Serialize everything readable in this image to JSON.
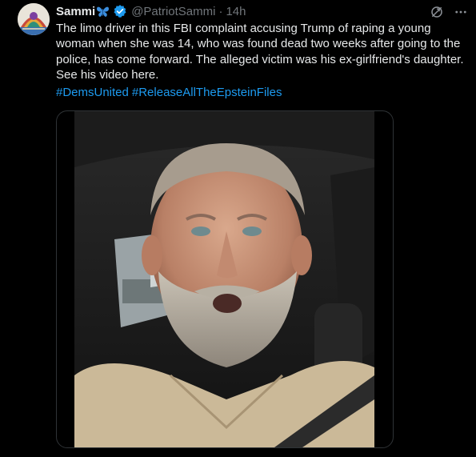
{
  "author": {
    "name": "Sammi",
    "handle": "@PatriotSammi",
    "separator": "·",
    "time": "14h",
    "verified_icon": "verified-badge-icon",
    "emoji_icon": "butterfly-icon"
  },
  "tweet": {
    "text": "The limo driver in this FBI complaint accusing Trump of raping a young woman when she was 14, who was found dead two weeks after going to the police, has come forward. The alleged victim was his ex-girlfriend's daughter. See his video here.",
    "hashtags": [
      "#DemsUnited",
      "#ReleaseAllTheEpsteinFiles"
    ]
  },
  "icons": {
    "grok": "grok-icon",
    "more": "more-options-icon"
  },
  "media": {
    "type": "video",
    "description_icon": "video-thumbnail"
  },
  "colors": {
    "background": "#000000",
    "text": "#e7e9ea",
    "secondary": "#71767b",
    "link": "#1d9bf0",
    "border": "#2f3336"
  }
}
